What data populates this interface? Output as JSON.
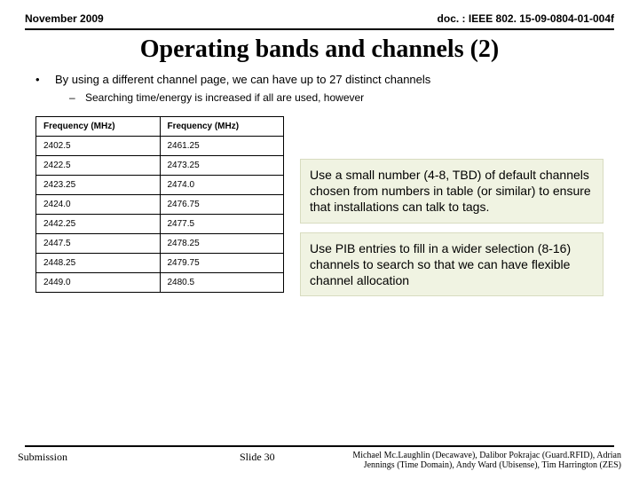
{
  "header": {
    "date": "November 2009",
    "doc_ref": "doc. : IEEE 802. 15-09-0804-01-004f"
  },
  "title": "Operating bands and channels (2)",
  "bullet": {
    "mark": "•",
    "text": "By using a different channel page, we can have up to 27 distinct channels"
  },
  "subbullet": {
    "mark": "–",
    "text": "Searching time/energy is increased if all are used, however"
  },
  "table": {
    "head_left": "Frequency (MHz)",
    "head_right": "Frequency (MHz)",
    "rows": [
      {
        "l": "2402.5",
        "r": "2461.25"
      },
      {
        "l": "2422.5",
        "r": "2473.25"
      },
      {
        "l": "2423.25",
        "r": "2474.0"
      },
      {
        "l": "2424.0",
        "r": "2476.75"
      },
      {
        "l": "2442.25",
        "r": "2477.5"
      },
      {
        "l": "2447.5",
        "r": "2478.25"
      },
      {
        "l": "2448.25",
        "r": "2479.75"
      },
      {
        "l": "2449.0",
        "r": "2480.5"
      }
    ]
  },
  "notes": {
    "a": "Use a small number (4-8, TBD) of default channels chosen from numbers in table (or similar) to ensure that installations can talk to tags.",
    "b": "Use PIB entries to fill in a wider selection (8-16) channels to search so that we can have flexible channel allocation"
  },
  "footer": {
    "left": "Submission",
    "center": "Slide 30",
    "right": "Michael Mc.Laughlin (Decawave), Dalibor Pokrajac (Guard.RFID), Adrian Jennings (Time Domain), Andy Ward (Ubisense), Tim Harrington (ZES)"
  }
}
